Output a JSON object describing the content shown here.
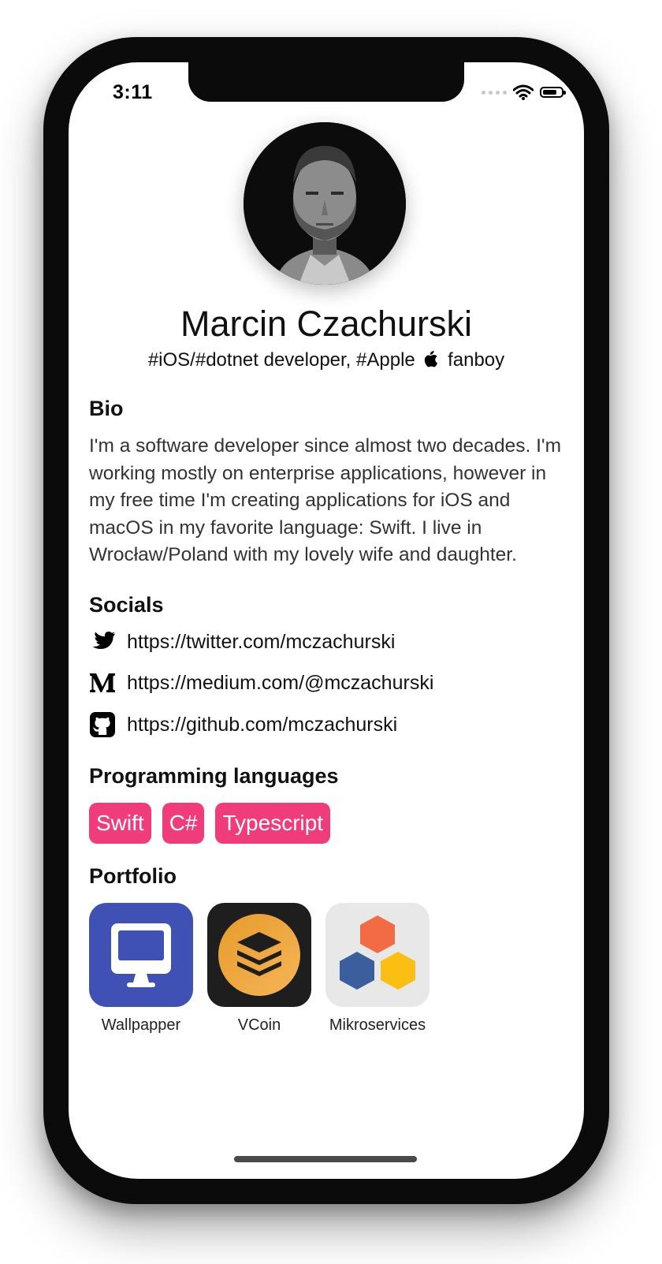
{
  "status_bar": {
    "time": "3:11"
  },
  "profile": {
    "name": "Marcin Czachurski",
    "tagline_prefix": "#iOS/#dotnet developer, #Apple",
    "tagline_suffix": "fanboy"
  },
  "bio": {
    "title": "Bio",
    "text": "I'm a software developer since almost two decades. I'm working mostly on enterprise applications, however in my free time I'm creating applications for iOS and macOS in my favorite language: Swift. I live in Wrocław/Poland with my lovely wife and daughter."
  },
  "socials": {
    "title": "Socials",
    "items": [
      {
        "icon": "twitter-icon",
        "url": "https://twitter.com/mczachurski"
      },
      {
        "icon": "medium-icon",
        "url": "https://medium.com/@mczachurski"
      },
      {
        "icon": "github-icon",
        "url": "https://github.com/mczachurski"
      }
    ]
  },
  "languages": {
    "title": "Programming languages",
    "items": [
      "Swift",
      "C#",
      "Typescript"
    ],
    "tag_color": "#f13c7c"
  },
  "portfolio": {
    "title": "Portfolio",
    "items": [
      {
        "label": "Wallpapper",
        "icon": "monitor-icon",
        "color": "#3f51b5"
      },
      {
        "label": "VCoin",
        "icon": "layers-icon",
        "color": "#f0a63a"
      },
      {
        "label": "Mikroservices",
        "icon": "hexagons-icon",
        "color": "#e8e8e8"
      }
    ]
  }
}
